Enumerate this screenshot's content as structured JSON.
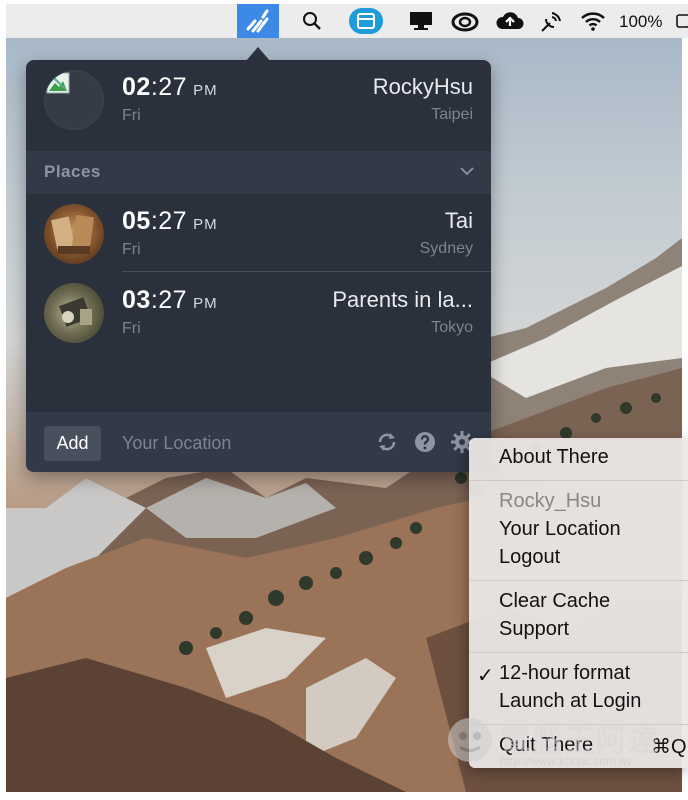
{
  "menubar": {
    "icons": [
      "there-app-icon",
      "spotlight-search-icon",
      "app-window-icon",
      "display-icon",
      "creative-cloud-icon",
      "cloud-upload-icon",
      "satellite-icon",
      "wifi-icon",
      "battery-icon"
    ],
    "battery_percent": "100%",
    "accent": "#3d8ae6"
  },
  "popover": {
    "me": {
      "hour": "02",
      "minute": ":27",
      "ampm": "PM",
      "day": "Fri",
      "name": "RockyHsu",
      "city": "Taipei"
    },
    "places_label": "Places",
    "places": [
      {
        "hour": "05",
        "minute": ":27",
        "ampm": "PM",
        "day": "Fri",
        "name": "Tai",
        "city": "Sydney"
      },
      {
        "hour": "03",
        "minute": ":27",
        "ampm": "PM",
        "day": "Fri",
        "name": "Parents in la...",
        "city": "Tokyo"
      }
    ],
    "footer": {
      "add_label": "Add",
      "location_placeholder": "Your Location"
    },
    "colors": {
      "background": "#2a303c",
      "header": "#323947"
    }
  },
  "context_menu": {
    "about": "About There",
    "username": "Rocky_Hsu",
    "your_location": "Your Location",
    "logout": "Logout",
    "clear_cache": "Clear Cache",
    "support": "Support",
    "check_mark": "✓",
    "hour_format": "12-hour format",
    "hour_format_checked": true,
    "launch_at_login": "Launch at Login",
    "quit": "Quit There",
    "quit_shortcut": "⌘Q"
  },
  "watermark": {
    "text": "電腦王阿達",
    "url": "http://www.kocpc.com.tw"
  }
}
